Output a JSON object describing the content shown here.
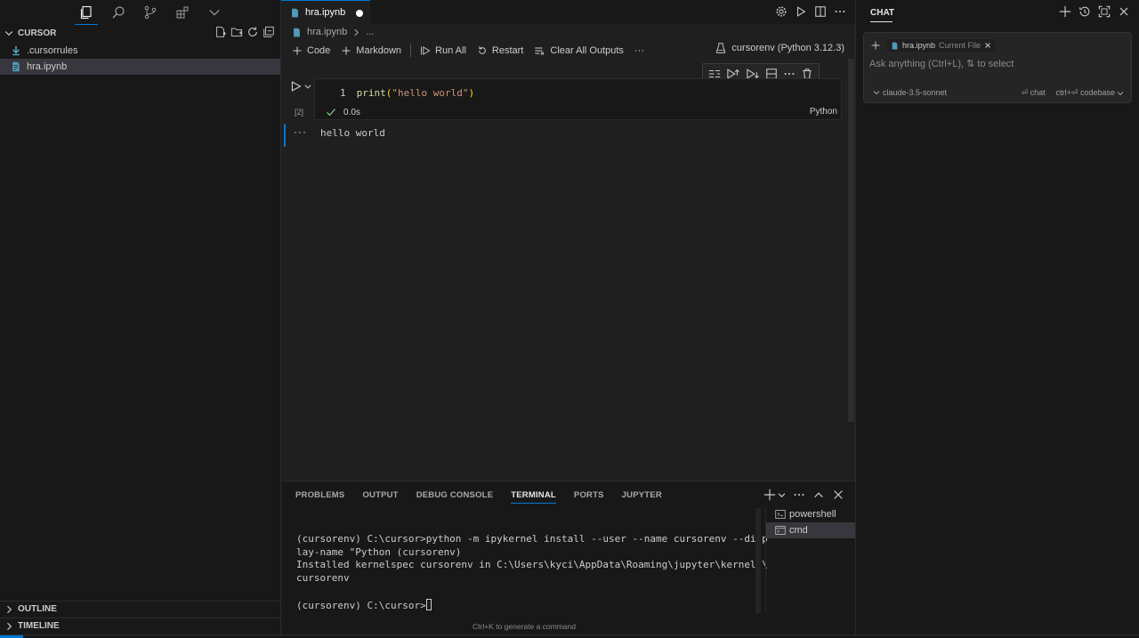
{
  "sidebar": {
    "section_title": "CURSOR",
    "files": [
      {
        "name": ".cursorrules",
        "icon": "download-arrow-icon",
        "selected": false
      },
      {
        "name": "hra.ipynb",
        "icon": "notebook-file-icon",
        "selected": true
      }
    ],
    "outline_label": "OUTLINE",
    "timeline_label": "TIMELINE"
  },
  "editor": {
    "tab_label": "hra.ipynb",
    "breadcrumb": {
      "file": "hra.ipynb",
      "more": "..."
    },
    "toolbar": {
      "code_label": "Code",
      "markdown_label": "Markdown",
      "run_all_label": "Run All",
      "restart_label": "Restart",
      "clear_outputs_label": "Clear All Outputs",
      "more_label": "···"
    },
    "kernel_label": "cursorenv (Python 3.12.3)",
    "cell": {
      "exec_count": "[2]",
      "line_number": "1",
      "code_fn": "print",
      "code_open": "(",
      "code_str": "\"hello world\"",
      "code_close": ")",
      "duration": "0.0s",
      "language": "Python",
      "output_more": "···",
      "output": "hello world"
    }
  },
  "panel": {
    "tabs": [
      "PROBLEMS",
      "OUTPUT",
      "DEBUG CONSOLE",
      "TERMINAL",
      "PORTS",
      "JUPYTER"
    ],
    "active_tab": "TERMINAL",
    "terminal_lines": [
      "(cursorenv) C:\\cursor>python -m ipykernel install --user --name cursorenv --disp",
      "lay-name \"Python (cursorenv)",
      "Installed kernelspec cursorenv in C:\\Users\\kyci\\AppData\\Roaming\\jupyter\\kernels\\",
      "cursorenv",
      "",
      "(cursorenv) C:\\cursor>"
    ],
    "hint": "Ctrl+K to generate a command",
    "terminals": [
      {
        "name": "powershell",
        "active": false
      },
      {
        "name": "cmd",
        "active": true
      }
    ]
  },
  "chat": {
    "title": "CHAT",
    "context_file": "hra.ipynb",
    "context_sub": "Current File",
    "input_placeholder": "Ask anything (Ctrl+L), ⇅ to select",
    "model": "claude-3.5-sonnet",
    "hint_chat": "⏎ chat",
    "hint_codebase": "ctrl+⏎ codebase"
  },
  "colors": {
    "accent": "#0078d4",
    "background": "#181818",
    "editor_bg": "#1f1f1f",
    "success": "#89d185"
  }
}
